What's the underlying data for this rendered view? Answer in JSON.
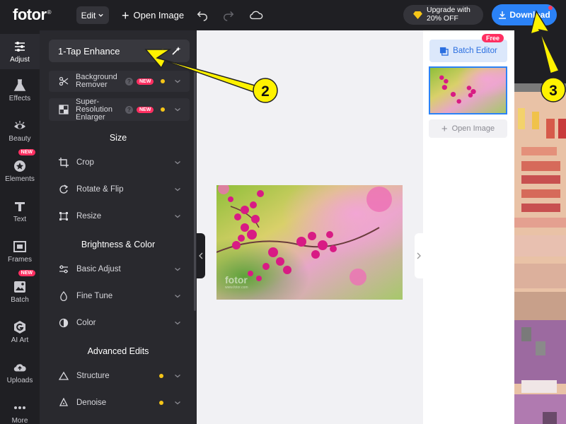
{
  "header": {
    "logo": "fotor",
    "logo_mark": "®",
    "edit_label": "Edit",
    "open_image_label": "Open Image",
    "upgrade_line1": "Upgrade with",
    "upgrade_line2": "20% OFF",
    "download_label": "Download"
  },
  "rail": {
    "items": [
      {
        "label": "Adjust",
        "icon": "sliders-icon"
      },
      {
        "label": "Effects",
        "icon": "flask-icon"
      },
      {
        "label": "Beauty",
        "icon": "eye-icon"
      },
      {
        "label": "Elements",
        "icon": "star-icon",
        "badge": "NEW"
      },
      {
        "label": "Text",
        "icon": "text-icon"
      },
      {
        "label": "Frames",
        "icon": "frame-icon"
      },
      {
        "label": "Batch",
        "icon": "batch-icon",
        "badge": "NEW"
      },
      {
        "label": "AI Art",
        "icon": "ai-art-icon"
      },
      {
        "label": "Uploads",
        "icon": "cloud-upload-icon"
      },
      {
        "label": "More",
        "icon": "more-icon"
      }
    ]
  },
  "panel": {
    "enhance_label": "1-Tap Enhance",
    "features": [
      {
        "label": "Background Remover",
        "badge": "NEW"
      },
      {
        "label": "Super-Resolution Enlarger",
        "badge": "NEW"
      }
    ],
    "sections": {
      "size": "Size",
      "brightness": "Brightness & Color",
      "advanced": "Advanced Edits"
    },
    "size_items": [
      "Crop",
      "Rotate & Flip",
      "Resize"
    ],
    "brightness_items": [
      "Basic Adjust",
      "Fine Tune",
      "Color"
    ],
    "advanced_items": [
      "Structure",
      "Denoise"
    ]
  },
  "canvas": {
    "watermark": "fotor",
    "watermark_sub": "www.fotor.com"
  },
  "batch_panel": {
    "batch_editor_label": "Batch Editor",
    "free_badge": "Free",
    "open_image_label": "Open Image"
  },
  "annotations": {
    "callout_2": "2",
    "callout_3": "3"
  },
  "colors": {
    "accent": "#2b82f6",
    "badge": "#ff2f61",
    "callout": "#fff200",
    "dark": "#1f1f23",
    "panel": "#29292e"
  }
}
